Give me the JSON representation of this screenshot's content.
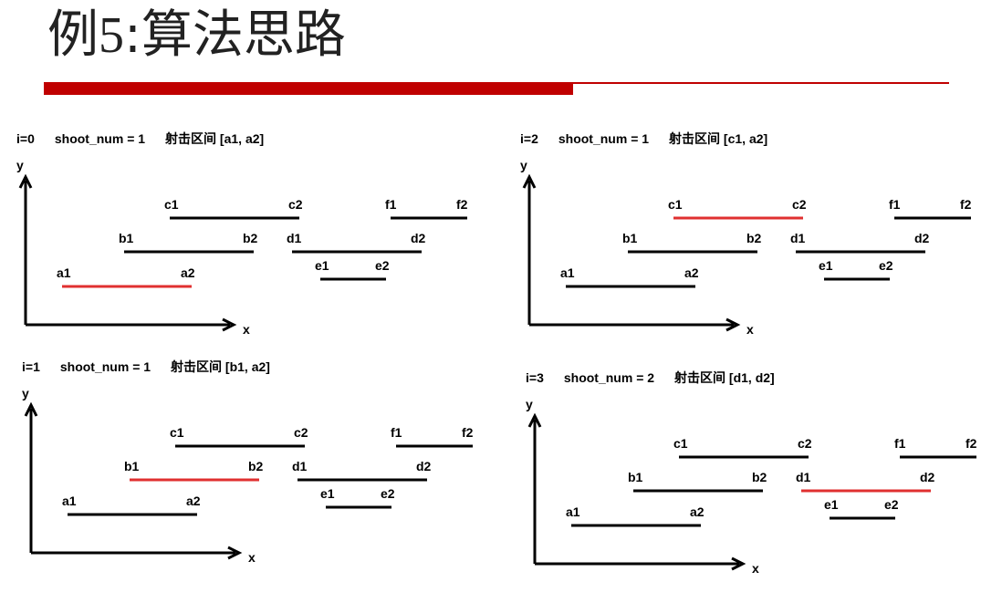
{
  "title": {
    "prefix": "例",
    "number": "5",
    "rest": ":算法思路"
  },
  "colors": {
    "accent": "#c00000",
    "highlight": "#e03030",
    "line": "#000000"
  },
  "panels": [
    {
      "id": "p0",
      "header": {
        "i": "i=0",
        "shoot": "shoot_num = 1",
        "range": "射击区间 [a1, a2]"
      },
      "axes": {
        "x": "x",
        "y": "y"
      },
      "highlight": "a",
      "segments": [
        {
          "id": "a",
          "start": "a1",
          "end": "a2"
        },
        {
          "id": "b",
          "start": "b1",
          "end": "b2"
        },
        {
          "id": "c",
          "start": "c1",
          "end": "c2"
        },
        {
          "id": "d",
          "start": "d1",
          "end": "d2"
        },
        {
          "id": "e",
          "start": "e1",
          "end": "e2"
        },
        {
          "id": "f",
          "start": "f1",
          "end": "f2"
        }
      ]
    },
    {
      "id": "p2",
      "header": {
        "i": "i=2",
        "shoot": "shoot_num = 1",
        "range": "射击区间 [c1, a2]"
      },
      "axes": {
        "x": "x",
        "y": "y"
      },
      "highlight": "c",
      "segments": [
        {
          "id": "a",
          "start": "a1",
          "end": "a2"
        },
        {
          "id": "b",
          "start": "b1",
          "end": "b2"
        },
        {
          "id": "c",
          "start": "c1",
          "end": "c2"
        },
        {
          "id": "d",
          "start": "d1",
          "end": "d2"
        },
        {
          "id": "e",
          "start": "e1",
          "end": "e2"
        },
        {
          "id": "f",
          "start": "f1",
          "end": "f2"
        }
      ]
    },
    {
      "id": "p1",
      "header": {
        "i": "i=1",
        "shoot": "shoot_num = 1",
        "range": "射击区间 [b1, a2]"
      },
      "axes": {
        "x": "x",
        "y": "y"
      },
      "highlight": "b",
      "segments": [
        {
          "id": "a",
          "start": "a1",
          "end": "a2"
        },
        {
          "id": "b",
          "start": "b1",
          "end": "b2"
        },
        {
          "id": "c",
          "start": "c1",
          "end": "c2"
        },
        {
          "id": "d",
          "start": "d1",
          "end": "d2"
        },
        {
          "id": "e",
          "start": "e1",
          "end": "e2"
        },
        {
          "id": "f",
          "start": "f1",
          "end": "f2"
        }
      ]
    },
    {
      "id": "p3",
      "header": {
        "i": "i=3",
        "shoot": "shoot_num = 2",
        "range": "射击区间 [d1, d2]"
      },
      "axes": {
        "x": "x",
        "y": "y"
      },
      "highlight": "d",
      "segments": [
        {
          "id": "a",
          "start": "a1",
          "end": "a2"
        },
        {
          "id": "b",
          "start": "b1",
          "end": "b2"
        },
        {
          "id": "c",
          "start": "c1",
          "end": "c2"
        },
        {
          "id": "d",
          "start": "d1",
          "end": "d2"
        },
        {
          "id": "e",
          "start": "e1",
          "end": "e2"
        },
        {
          "id": "f",
          "start": "f1",
          "end": "f2"
        }
      ]
    }
  ]
}
